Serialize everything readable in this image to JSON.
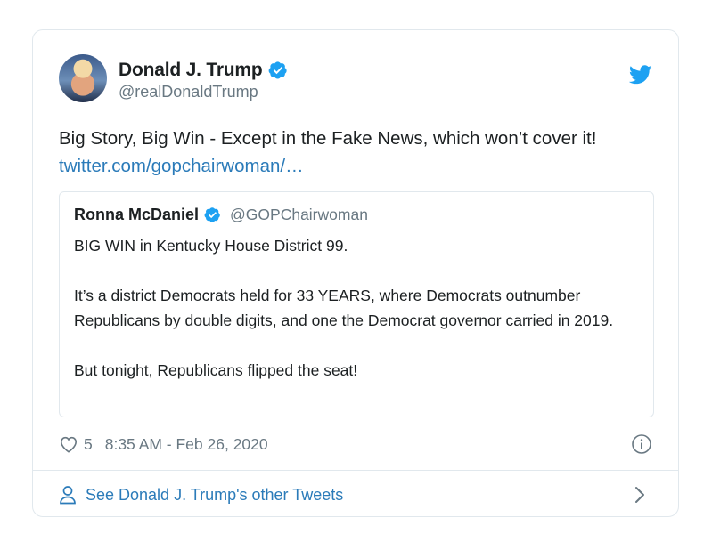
{
  "author": {
    "name": "Donald J. Trump",
    "handle": "@realDonaldTrump",
    "avatar_icon": "profile-photo"
  },
  "tweet": {
    "text": "Big Story, Big Win - Except in the Fake News, which won’t cover it! ",
    "link": "twitter.com/gopchairwoman/…"
  },
  "quoted_tweet": {
    "name": "Ronna McDaniel",
    "handle": "@GOPChairwoman",
    "paragraphs": [
      "BIG WIN in Kentucky House District 99.",
      "It’s a district Democrats held for 33 YEARS, where Democrats outnumber Republicans by double digits, and one the Democrat governor carried in 2019.",
      "But tonight, Republicans flipped the seat!"
    ]
  },
  "meta": {
    "likes": "5",
    "timestamp": "8:35 AM - Feb 26, 2020"
  },
  "footer": {
    "label": "See Donald J. Trump's other Tweets"
  },
  "colors": {
    "link": "#2b7bb9",
    "verified": "#1da1f2",
    "twitter_blue": "#1da1f2",
    "muted": "#697882",
    "border": "#e1e8ed"
  }
}
